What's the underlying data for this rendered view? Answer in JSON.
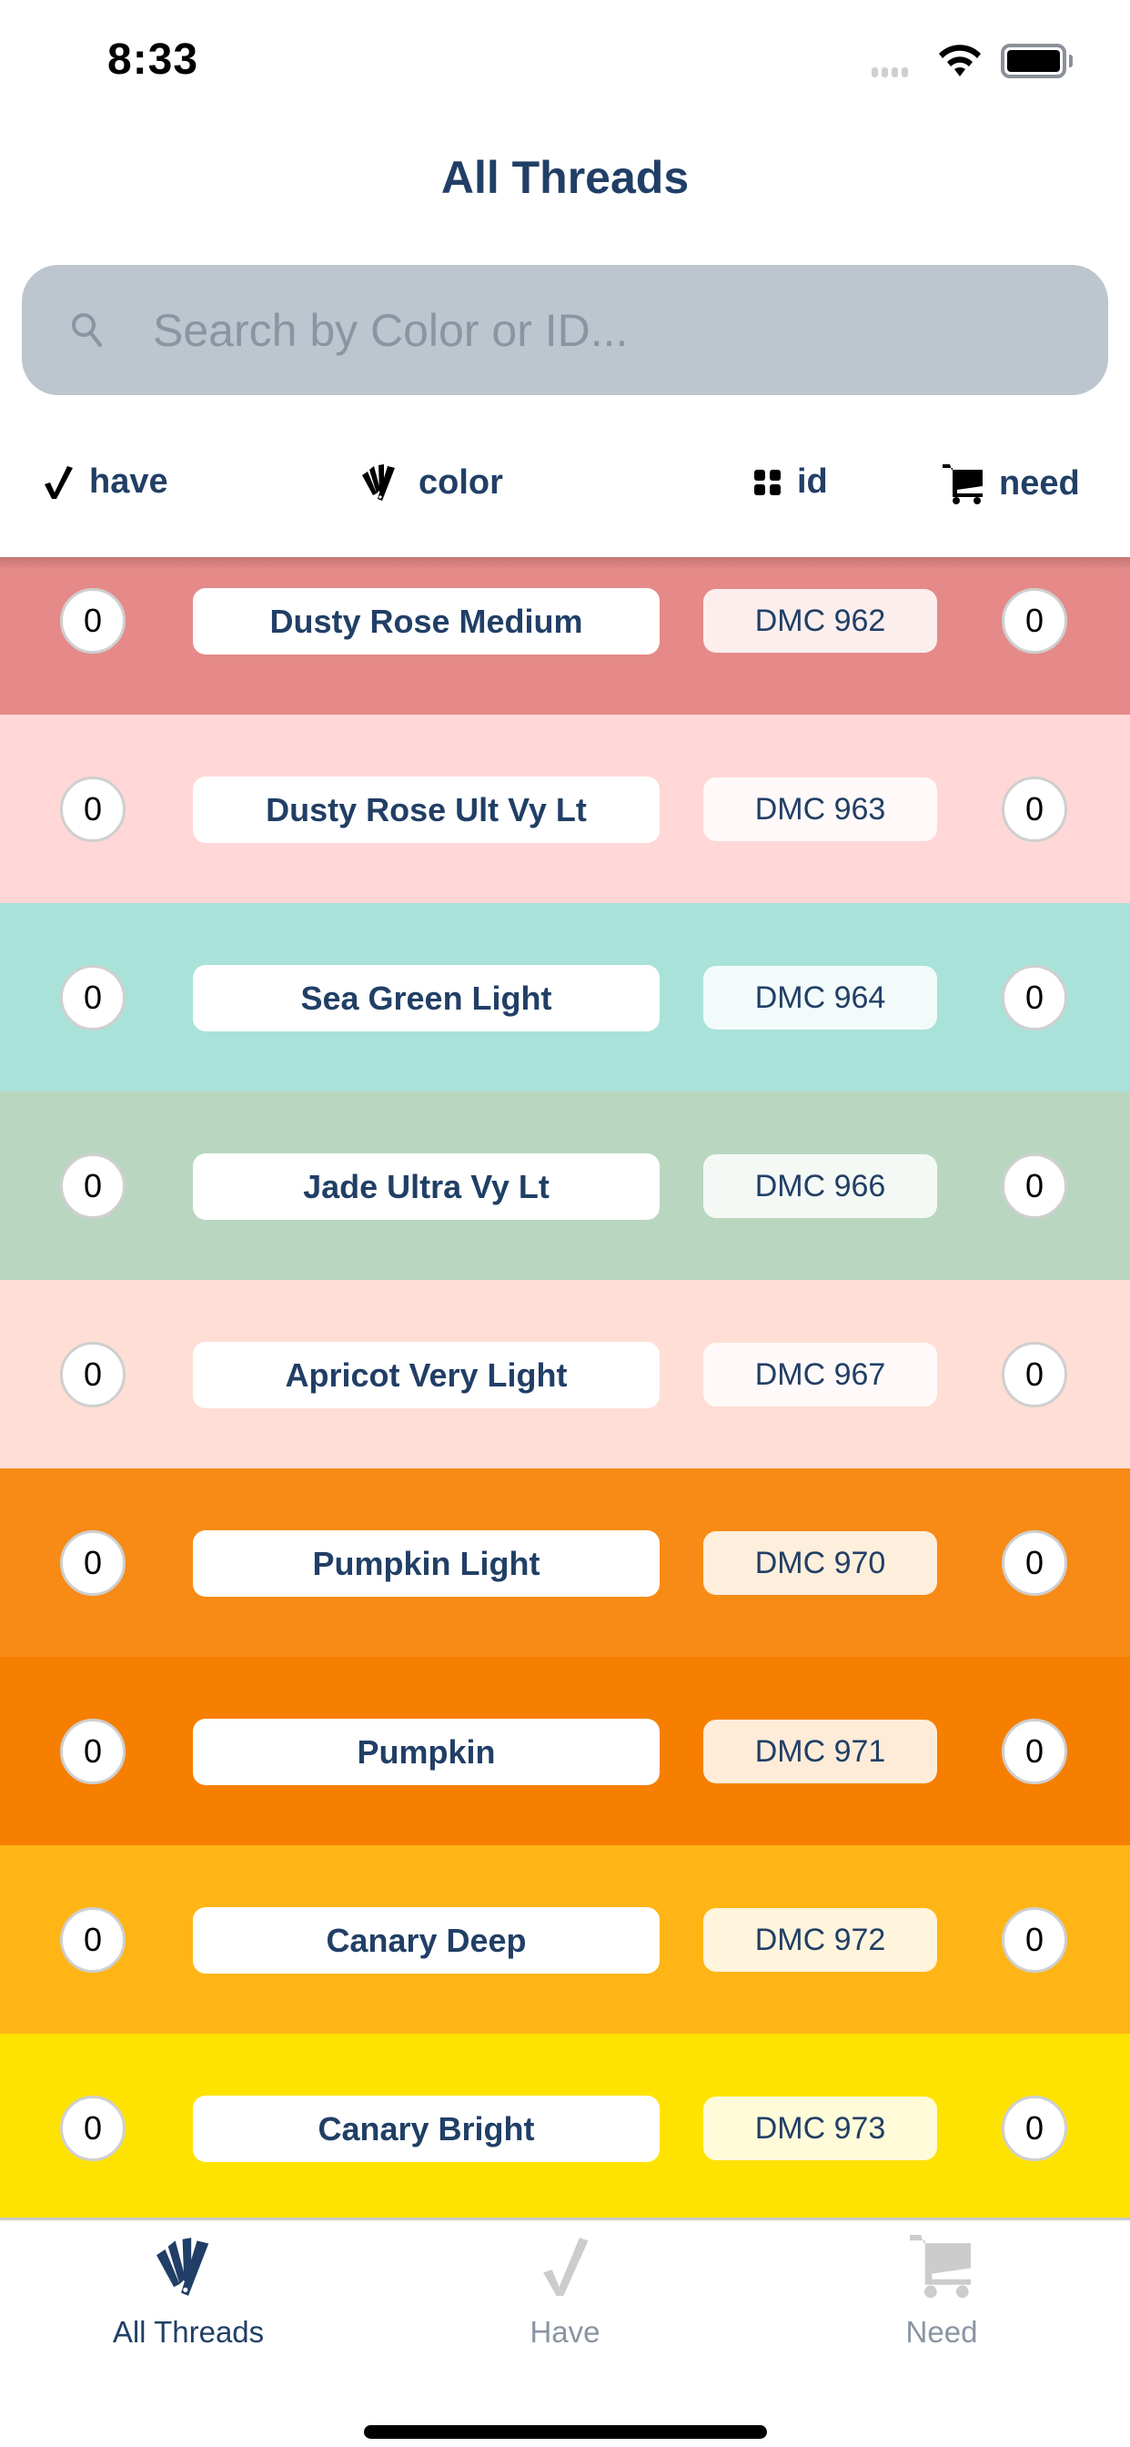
{
  "status_bar": {
    "time": "8:33"
  },
  "header": {
    "title": "All Threads"
  },
  "search": {
    "placeholder": "Search by Color or ID...",
    "value": ""
  },
  "columns": {
    "have": {
      "label": "have",
      "icon": "checkmark-icon"
    },
    "color": {
      "label": "color",
      "icon": "color-fan-icon"
    },
    "id": {
      "label": "id",
      "icon": "grid-icon"
    },
    "need": {
      "label": "need",
      "icon": "cart-icon"
    }
  },
  "colors": {
    "accent": "#213f66",
    "inactive": "#8a95a2",
    "search_bg": "#bdc5ce"
  },
  "threads": [
    {
      "name": "Dusty Rose Medium",
      "id": "DMC 962",
      "have": "0",
      "need": "0",
      "color": "#e58a88"
    },
    {
      "name": "Dusty Rose Ult Vy Lt",
      "id": "DMC 963",
      "have": "0",
      "need": "0",
      "color": "#ffd7d7"
    },
    {
      "name": "Sea Green Light",
      "id": "DMC 964",
      "have": "0",
      "need": "0",
      "color": "#a9e2d9"
    },
    {
      "name": "Jade Ultra Vy Lt",
      "id": "DMC 966",
      "have": "0",
      "need": "0",
      "color": "#b9d7c0"
    },
    {
      "name": "Apricot Very Light",
      "id": "DMC 967",
      "have": "0",
      "need": "0",
      "color": "#ffded5"
    },
    {
      "name": "Pumpkin Light",
      "id": "DMC 970",
      "have": "0",
      "need": "0",
      "color": "#f78b16"
    },
    {
      "name": "Pumpkin",
      "id": "DMC 971",
      "have": "0",
      "need": "0",
      "color": "#f67f00"
    },
    {
      "name": "Canary Deep",
      "id": "DMC 972",
      "have": "0",
      "need": "0",
      "color": "#ffb515"
    },
    {
      "name": "Canary Bright",
      "id": "DMC 973",
      "have": "0",
      "need": "0",
      "color": "#ffe300"
    }
  ],
  "tabs": [
    {
      "label": "All Threads",
      "icon": "color-fan-icon",
      "active": true
    },
    {
      "label": "Have",
      "icon": "checkmark-icon",
      "active": false
    },
    {
      "label": "Need",
      "icon": "cart-icon",
      "active": false
    }
  ]
}
